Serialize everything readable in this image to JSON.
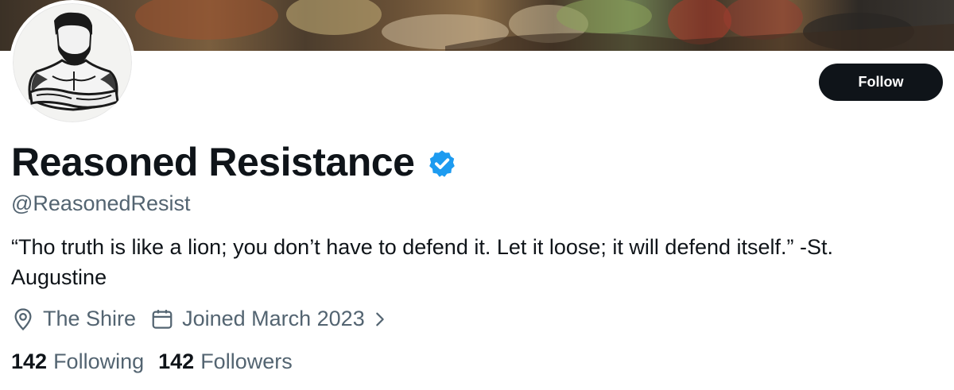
{
  "profile": {
    "display_name": "Reasoned Resistance",
    "handle": "@ReasonedResist",
    "bio": "“Tho truth is like a lion; you don’t have to defend it. Let it loose; it will defend itself.” -St. Augustine",
    "location": "The Shire",
    "joined": "Joined March 2023",
    "verified_icon": "verified-badge-icon",
    "verified_color": "#1d9bf0"
  },
  "actions": {
    "follow_label": "Follow"
  },
  "counts": {
    "following_num": "142",
    "following_label": "Following",
    "followers_num": "142",
    "followers_label": "Followers"
  },
  "colors": {
    "text_primary": "#0f1419",
    "text_secondary": "#536471",
    "button_bg": "#0f1419"
  }
}
